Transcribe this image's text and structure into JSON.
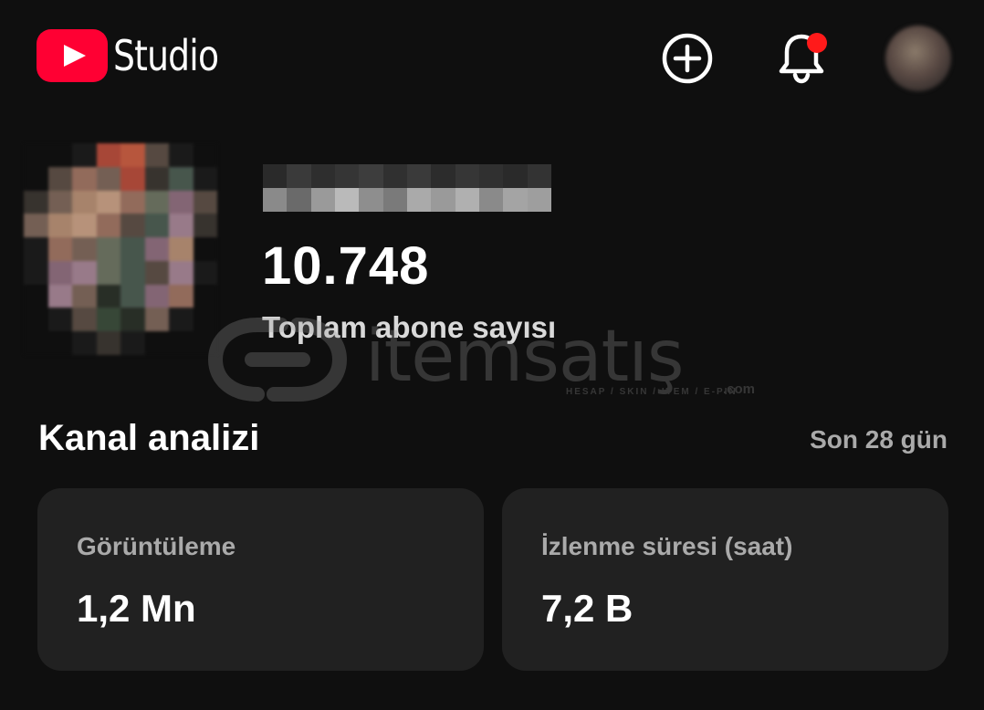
{
  "header": {
    "app_name": "Studio",
    "icons": {
      "logo": "youtube-play-icon",
      "create": "plus-circle-icon",
      "notifications": "bell-icon",
      "account": "account-avatar"
    },
    "notification_badge": true
  },
  "channel": {
    "subscriber_count": "10.748",
    "subscriber_label": "Toplam abone sayısı"
  },
  "watermark": {
    "brand": "itemsatış",
    "tagline": "HESAP / SKIN / ITEM / E-PIN",
    "domain": ".com"
  },
  "analytics": {
    "title": "Kanal analizi",
    "period": "Son 28 gün",
    "cards": [
      {
        "label": "Görüntüleme",
        "value": "1,2 Mn"
      },
      {
        "label": "İzlenme süresi (saat)",
        "value": "7,2 B"
      }
    ]
  },
  "colors": {
    "background": "#0f0f0f",
    "card": "#212121",
    "brand_red": "#ff0033",
    "badge_red": "#ff1a1a",
    "secondary_text": "#aaaaaa"
  }
}
